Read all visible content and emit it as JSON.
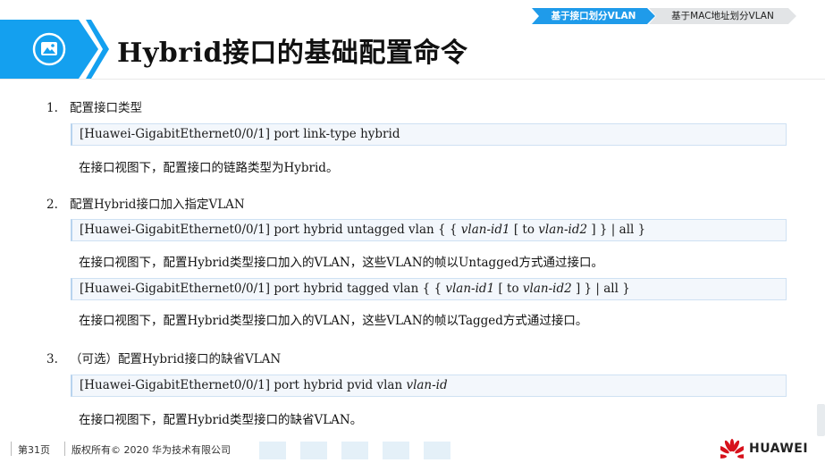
{
  "breadcrumb": {
    "active": "基于接口划分VLAN",
    "inactive": "基于MAC地址划分VLAN"
  },
  "title": "Hybrid接口的基础配置命令",
  "sections": [
    {
      "num": "1.",
      "heading": "配置接口类型",
      "commands": [
        {
          "prefix": "[Huawei-GigabitEthernet0/0/1] port link-type hybrid",
          "desc": "在接口视图下，配置接口的链路类型为Hybrid。"
        }
      ]
    },
    {
      "num": "2.",
      "heading": "配置Hybrid接口加入指定VLAN",
      "commands": [
        {
          "prefix": "[Huawei-GigabitEthernet0/0/1] port hybrid untagged vlan { { ",
          "arg1": "vlan-id1",
          "mid1": " [ to ",
          "arg2": "vlan-id2",
          "suffix": " ] } | all }",
          "desc": "在接口视图下，配置Hybrid类型接口加入的VLAN，这些VLAN的帧以Untagged方式通过接口。"
        },
        {
          "prefix": "[Huawei-GigabitEthernet0/0/1] port hybrid tagged vlan { { ",
          "arg1": "vlan-id1",
          "mid1": " [ to ",
          "arg2": "vlan-id2",
          "suffix": " ] } | all }",
          "desc": "在接口视图下，配置Hybrid类型接口加入的VLAN，这些VLAN的帧以Tagged方式通过接口。"
        }
      ]
    },
    {
      "num": "3.",
      "heading": "（可选）配置Hybrid接口的缺省VLAN",
      "commands": [
        {
          "prefix": "[Huawei-GigabitEthernet0/0/1] port hybrid pvid vlan ",
          "arg1": "vlan-id",
          "desc": "在接口视图下，配置Hybrid类型接口的缺省VLAN。"
        }
      ]
    }
  ],
  "footer": {
    "page": "第31页",
    "copyright": "版权所有© 2020 华为技术有限公司",
    "brand": "HUAWEI"
  },
  "colors": {
    "accent": "#14a0ef",
    "breadcrumb_active": "#1f9bea",
    "cmd_bg": "#f3f7fc"
  },
  "icons": {
    "logo": "image-icon",
    "brand": "huawei-petal-logo"
  }
}
